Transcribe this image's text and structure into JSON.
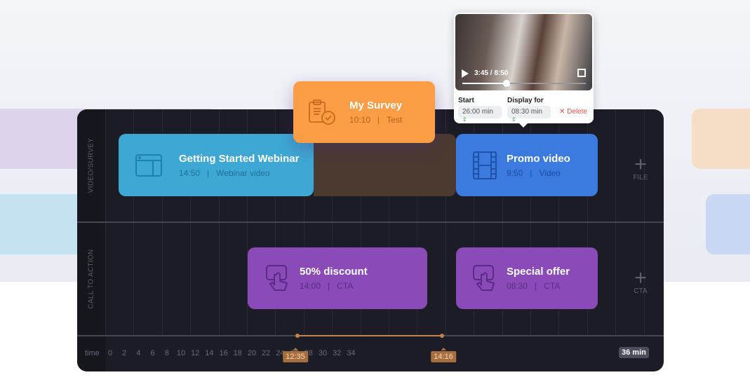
{
  "rows": {
    "video_survey": "VIDEO/SURVEY",
    "cta": "CALL TO ACTION"
  },
  "cards": {
    "webinar": {
      "title": "Getting Started Webinar",
      "time": "14:50",
      "type": "Webinar video",
      "color": "#3ea8d4"
    },
    "survey": {
      "title": "My Survey",
      "time": "10:10",
      "type": "Test",
      "color": "#fb9d45"
    },
    "promo": {
      "title": "Promo video",
      "time": "9:50",
      "type": "Video",
      "color": "#3b7be0"
    },
    "discount": {
      "title": "50% discount",
      "time": "14:00",
      "type": "CTA",
      "color": "#8a4bb9"
    },
    "special": {
      "title": "Special offer",
      "time": "08:30",
      "type": "CTA",
      "color": "#8a4bb9"
    }
  },
  "add_file": {
    "icon": "plus-icon",
    "label": "FILE"
  },
  "add_cta": {
    "icon": "plus-icon",
    "label": "CTA"
  },
  "popup": {
    "time": "3:45 / 8:50",
    "progress": 0.36,
    "start_label": "Start",
    "start_value": "26:00 min",
    "display_label": "Display for",
    "display_value": "08:30 min",
    "delete_label": "Delete"
  },
  "timeline": {
    "label": "time",
    "ticks": [
      "0",
      "2",
      "4",
      "6",
      "8",
      "10",
      "12",
      "14",
      "16",
      "18",
      "20",
      "22",
      "24",
      "26",
      "28",
      "30",
      "32",
      "34"
    ],
    "end": "36 min",
    "range_start": "12:35",
    "range_end": "14:16"
  }
}
